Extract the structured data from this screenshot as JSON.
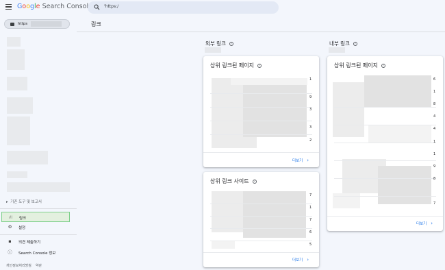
{
  "header": {
    "logo_parts": [
      "G",
      "o",
      "o",
      "g",
      "l",
      "e"
    ],
    "logo_rest": "Search Console",
    "search_text": "'https:/"
  },
  "sidebar": {
    "property_label": "https",
    "section_toggle": "기존 도구 및 보고서",
    "items": [
      {
        "label": "링크",
        "icon": "links-icon"
      },
      {
        "label": "설정",
        "icon": "gear-icon"
      },
      {
        "label": "의견 제출하기",
        "icon": "feedback-icon"
      },
      {
        "label": "Search Console 정보",
        "icon": "info-icon"
      }
    ],
    "footer": {
      "privacy": "개인정보처리방침",
      "terms": "약관"
    }
  },
  "main": {
    "page_title": "링크",
    "external": {
      "title": "외부 링크",
      "top_pages": {
        "title": "상위 링크된 페이지",
        "counts": [
          "1",
          "9",
          "3",
          "3",
          "2"
        ],
        "more": "더보기"
      },
      "top_sites": {
        "title": "상위 링크 사이트",
        "counts": [
          "7",
          "1",
          "7",
          "6",
          "5"
        ],
        "more": "더보기"
      }
    },
    "internal": {
      "title": "내부 링크",
      "top_pages": {
        "title": "상위 링크된 페이지",
        "counts": [
          "6",
          "1",
          "8",
          "4",
          "4",
          "1",
          "1",
          "9",
          "8",
          "7"
        ],
        "more": "더보기"
      }
    }
  },
  "colors": {
    "accent": "#1a73e8",
    "active_nav_bg": "#e3f0df",
    "active_nav_border": "#7dcf8a",
    "background": "#f3f6fc"
  }
}
